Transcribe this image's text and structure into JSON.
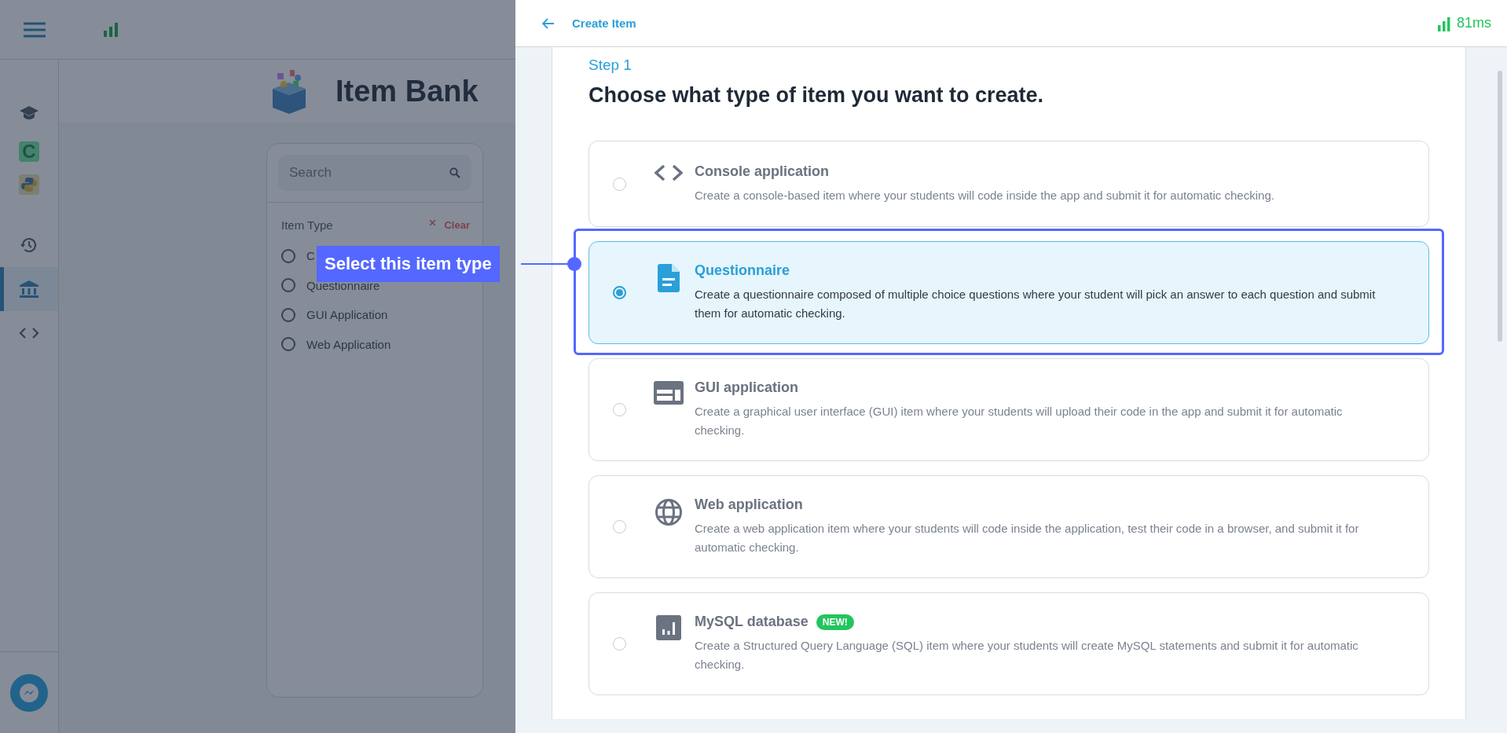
{
  "sidebar": {
    "items": [
      {
        "kind": "courses",
        "selected": false
      },
      {
        "kind": "c",
        "label": "C",
        "selected": false
      },
      {
        "kind": "python",
        "selected": false
      },
      {
        "kind": "history",
        "selected": false
      },
      {
        "kind": "bank",
        "selected": true
      },
      {
        "kind": "code",
        "selected": false
      }
    ]
  },
  "background_page": {
    "title": "Item Bank",
    "search": {
      "placeholder": "Search"
    },
    "filter": {
      "label": "Item Type",
      "clear": "Clear",
      "options": [
        {
          "label": "C",
          "selected": false
        },
        {
          "label": "Questionnaire",
          "selected": false
        },
        {
          "label": "GUI Application",
          "selected": false
        },
        {
          "label": "Web Application",
          "selected": false
        }
      ]
    }
  },
  "drawer": {
    "title": "Create Item",
    "latency": "81ms",
    "step": "Step 1",
    "heading": "Choose what type of item you want to create.",
    "options": [
      {
        "kind": "console",
        "title": "Console application",
        "description": "Create a console-based item where your students will code inside the app and submit it for automatic checking.",
        "selected": false
      },
      {
        "kind": "questionnaire",
        "title": "Questionnaire",
        "description": "Create a questionnaire composed of multiple choice questions where your student will pick an answer to each question and submit them for automatic checking.",
        "selected": true
      },
      {
        "kind": "gui",
        "title": "GUI application",
        "description": "Create a graphical user interface (GUI) item where your students will upload their code in the app and submit it for automatic checking.",
        "selected": false
      },
      {
        "kind": "web",
        "title": "Web application",
        "description": "Create a web application item where your students will code inside the application, test their code in a browser, and submit it for automatic checking.",
        "selected": false
      },
      {
        "kind": "database",
        "title": "MySQL database",
        "badge": "NEW!",
        "description": "Create a Structured Query Language (SQL) item where your students will create MySQL statements and submit it for automatic checking.",
        "selected": false
      }
    ]
  },
  "annotation": {
    "text": "Select this item type"
  }
}
